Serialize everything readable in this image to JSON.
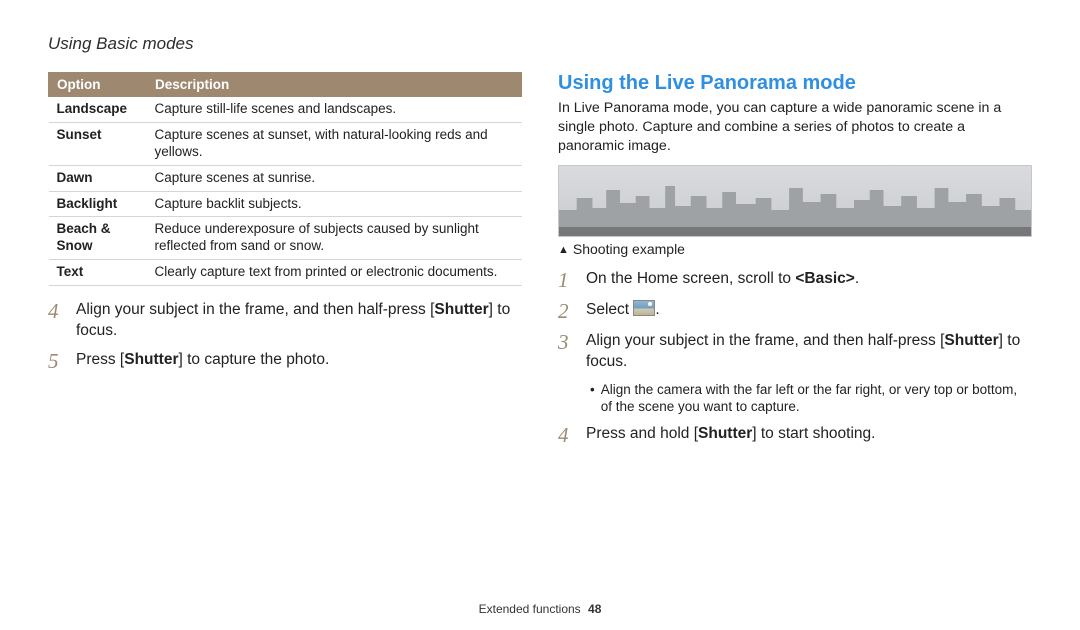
{
  "header": "Using Basic modes",
  "table": {
    "head": {
      "c0": "Option",
      "c1": "Description"
    },
    "rows": [
      {
        "c0": "Landscape",
        "c1": "Capture still-life scenes and landscapes."
      },
      {
        "c0": "Sunset",
        "c1": "Capture scenes at sunset, with natural-looking reds and yellows."
      },
      {
        "c0": "Dawn",
        "c1": "Capture scenes at sunrise."
      },
      {
        "c0": "Backlight",
        "c1": "Capture backlit subjects."
      },
      {
        "c0": "Beach & Snow",
        "c1": "Reduce underexposure of subjects caused by sunlight reflected from sand or snow."
      },
      {
        "c0": "Text",
        "c1": "Clearly capture text from printed or electronic documents."
      }
    ]
  },
  "left_steps": {
    "s4": {
      "num": "4",
      "pre": "Align your subject in the frame, and then half-press [",
      "b": "Shutter",
      "post": "] to focus."
    },
    "s5": {
      "num": "5",
      "pre": "Press [",
      "b": "Shutter",
      "post": "] to capture the photo."
    }
  },
  "right": {
    "title": "Using the Live Panorama mode",
    "intro": "In Live Panorama mode, you can capture a wide panoramic scene in a single photo. Capture and combine a series of photos to create a panoramic image.",
    "caption": "Shooting example",
    "s1": {
      "num": "1",
      "pre": "On the Home screen, scroll to ",
      "b": "<Basic>",
      "post": "."
    },
    "s2": {
      "num": "2",
      "pre": "Select ",
      "post": "."
    },
    "s3": {
      "num": "3",
      "pre": "Align your subject in the frame, and then half-press [",
      "b": "Shutter",
      "post": "] to focus."
    },
    "s3_bullet": "Align the camera with the far left or the far right, or very top or bottom, of the scene you want to capture.",
    "s4": {
      "num": "4",
      "pre": "Press and hold [",
      "b": "Shutter",
      "post": "] to start shooting."
    }
  },
  "footer": {
    "section": "Extended functions",
    "page": "48"
  }
}
